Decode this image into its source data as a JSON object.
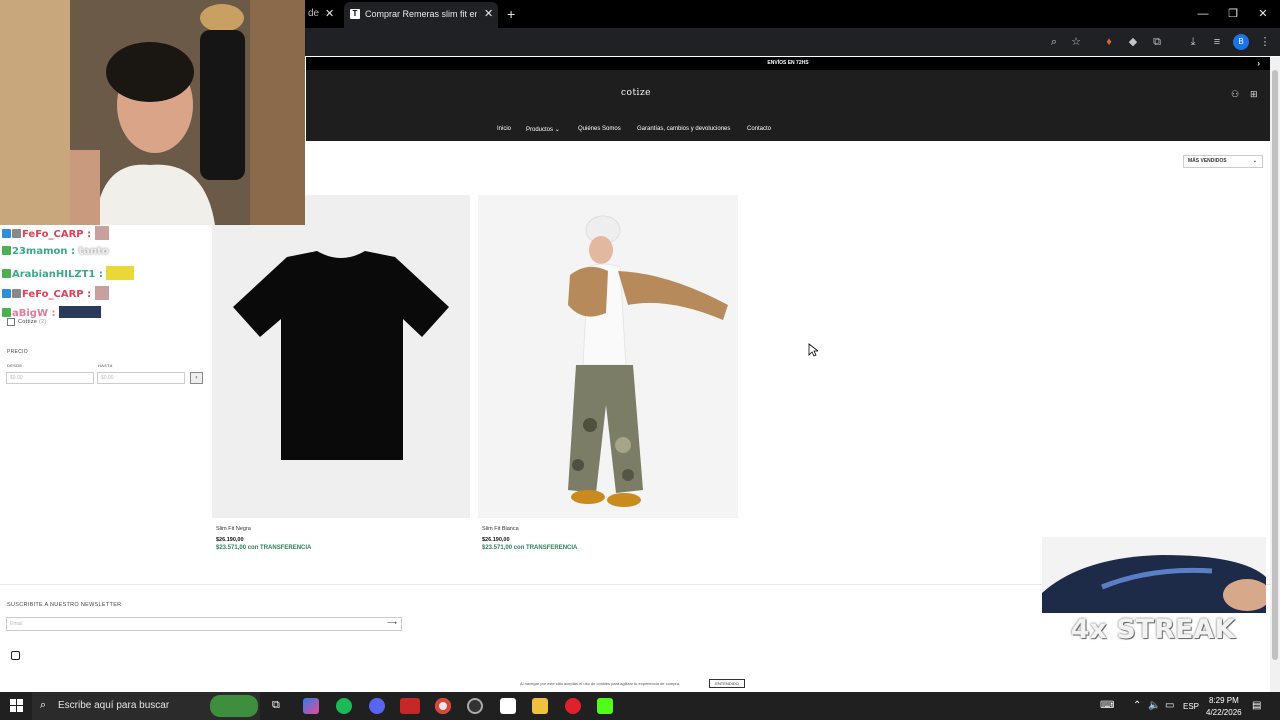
{
  "browser": {
    "prev_tab_label": "de",
    "tab_title": "Comprar Remeras slim fit en Co",
    "tab_favicon": "T",
    "new_tab": "+",
    "profile_initial": "B"
  },
  "store": {
    "announcement": "ENVÍOS EN 72HS",
    "logo": "cotize",
    "nav": [
      "Inicio",
      "Productos",
      "Quiénes Somos",
      "Garantías, cambios y devoluciones",
      "Contacto"
    ],
    "sort_label": "MÁS VENDIDOS",
    "filters": {
      "brand": "Cottize",
      "brand_count": "(2)",
      "price_label": "PRECIO",
      "from_label": "DESDE",
      "to_label": "HASTA",
      "from_placeholder": "$0.00",
      "to_placeholder": "$0.00"
    },
    "products": [
      {
        "name": "Slim Fit Negra",
        "price": "$26.190,00",
        "transfer_price": "$23.571,00",
        "transfer_label": "con TRANSFERENCIA"
      },
      {
        "name": "Slim Fit Blanca",
        "price": "$26.190,00",
        "transfer_price": "$23.571,00",
        "transfer_label": "con TRANSFERENCIA"
      }
    ],
    "newsletter_label": "SUSCRIBITE A NUESTRO NEWSLETTER",
    "email_placeholder": "Email",
    "cookie_text": "Al navegar por este sitio aceptás el uso de cookies para agilizar tu experiencia de compra.",
    "cookie_button": "ENTENDIDO"
  },
  "overlay": {
    "chat": [
      {
        "user": "FeFo_CARP",
        "message": ""
      },
      {
        "user": "23mamon",
        "message": "tanto"
      },
      {
        "user": "ArabianHILZT1",
        "message": ""
      },
      {
        "user": "FeFo_CARP",
        "message": ""
      },
      {
        "user": "aBigW",
        "message": ""
      }
    ],
    "streak": "4x STREAK"
  },
  "taskbar": {
    "search_placeholder": "Escribe aquí para buscar",
    "language": "ESP",
    "time": "8:29 PM",
    "date": "4/22/2026"
  },
  "colors": {
    "store_header": "#1e1e1e",
    "transfer_green": "#2a7d5a",
    "chat_red": "#e0405a",
    "chat_teal": "#3aa98a"
  }
}
